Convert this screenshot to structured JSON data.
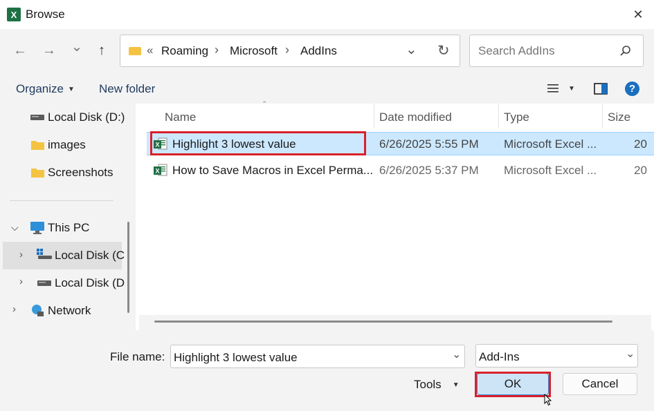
{
  "window": {
    "title": "Browse",
    "close_glyph": "✕",
    "app_icon_letter": "X"
  },
  "nav": {
    "back_glyph": "←",
    "forward_glyph": "→",
    "recent_glyph": "⌄",
    "up_glyph": "↑",
    "overflow": "«",
    "breadcrumb": [
      "Roaming",
      "Microsoft",
      "AddIns"
    ],
    "separator": "›",
    "dropdown_glyph": "⌄",
    "refresh_glyph": "↻",
    "search_placeholder": "Search AddIns"
  },
  "commands": {
    "organize_label": "Organize",
    "new_folder_label": "New folder",
    "help_glyph": "?"
  },
  "sidebar": {
    "items": [
      {
        "label": "Local Disk (D:)",
        "icon": "drive-icon"
      },
      {
        "label": "images",
        "icon": "folder-icon"
      },
      {
        "label": "Screenshots",
        "icon": "folder-icon"
      },
      {
        "label": "This PC",
        "icon": "computer-icon"
      },
      {
        "label": "Local Disk (C",
        "icon": "windows-drive-icon"
      },
      {
        "label": "Local Disk (D",
        "icon": "drive-icon"
      },
      {
        "label": "Network",
        "icon": "network-icon"
      }
    ]
  },
  "columns": {
    "name": "Name",
    "date": "Date modified",
    "type": "Type",
    "size": "Size"
  },
  "files": [
    {
      "name": "Highlight 3 lowest value",
      "date": "6/26/2025 5:55 PM",
      "type": "Microsoft Excel ...",
      "size": "20",
      "selected": true
    },
    {
      "name": "How to Save Macros in Excel Perma...",
      "date": "6/26/2025 5:37 PM",
      "type": "Microsoft Excel ...",
      "size": "20",
      "selected": false
    }
  ],
  "footer": {
    "file_name_label": "File name:",
    "file_name_value": "Highlight 3 lowest value",
    "filter_value": "Add-Ins",
    "tools_label": "Tools",
    "ok_label": "OK",
    "cancel_label": "Cancel"
  },
  "colors": {
    "accent": "#0067c0",
    "selection": "#cce8ff",
    "highlight_box": "#d9202a",
    "excel_green": "#1e7145"
  }
}
